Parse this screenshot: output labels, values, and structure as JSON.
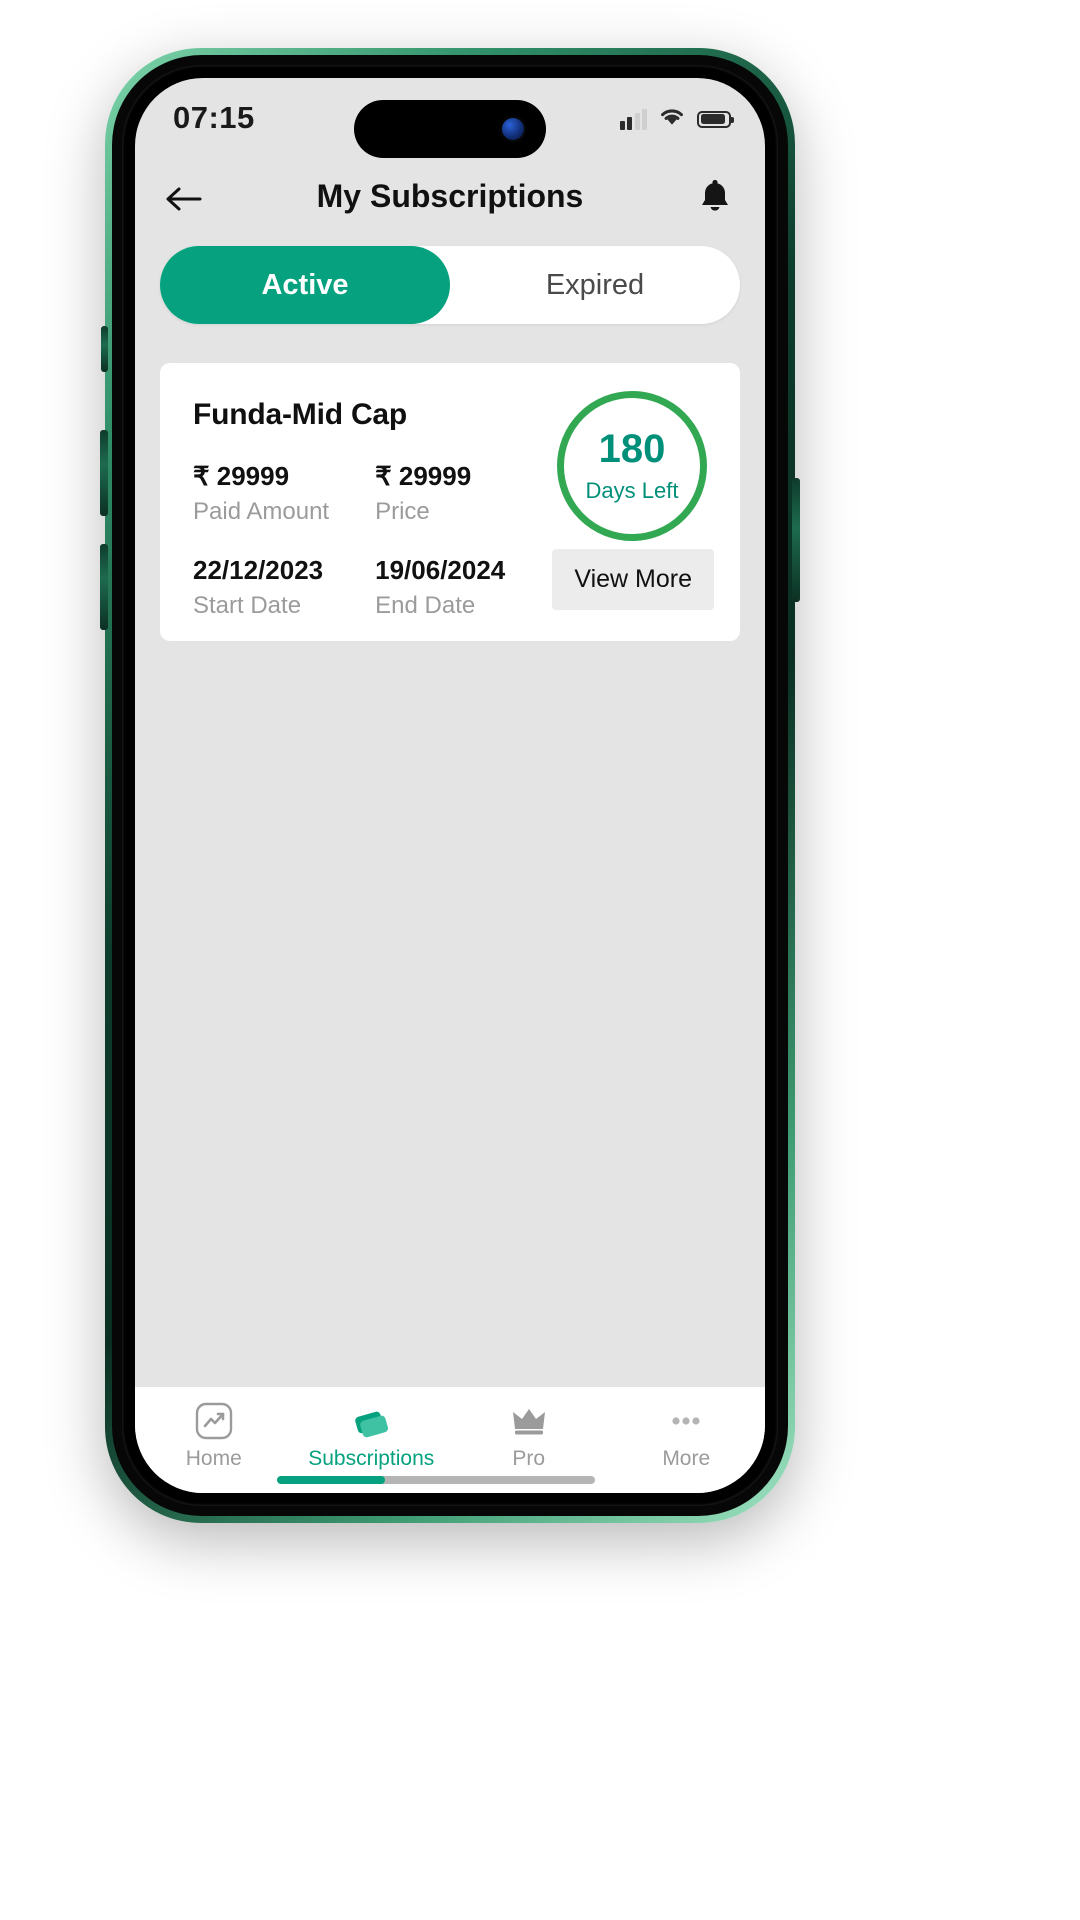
{
  "status_bar": {
    "time": "07:15",
    "signal_icon": "cellular-signal-icon",
    "signal_bars_filled": 2,
    "signal_bars_total": 4,
    "wifi_icon": "wifi-icon",
    "battery_icon": "battery-icon",
    "battery_level_percent": 80
  },
  "app_bar": {
    "back_icon": "arrow-left-icon",
    "title": "My Subscriptions",
    "notification_icon": "bell-icon"
  },
  "tabs": {
    "items": [
      {
        "label": "Active",
        "active": true
      },
      {
        "label": "Expired",
        "active": false
      }
    ]
  },
  "subscription_card": {
    "title": "Funda-Mid Cap",
    "paid_amount_value": "₹ 29999",
    "paid_amount_label": "Paid Amount",
    "price_value": "₹ 29999",
    "price_label": "Price",
    "start_date_value": "22/12/2023",
    "start_date_label": "Start Date",
    "end_date_value": "19/06/2024",
    "end_date_label": "End Date",
    "days_left_number": "180",
    "days_left_label": "Days Left",
    "view_more_label": "View More"
  },
  "bottom_nav": {
    "items": [
      {
        "label": "Home",
        "icon": "trending-chart-icon",
        "active": false
      },
      {
        "label": "Subscriptions",
        "icon": "cards-stack-icon",
        "active": true
      },
      {
        "label": "Pro",
        "icon": "crown-icon",
        "active": false
      },
      {
        "label": "More",
        "icon": "three-dots-icon",
        "active": false
      }
    ]
  },
  "colors": {
    "accent_teal": "#06a27f",
    "ring_green": "#32a852",
    "days_text": "#00907a",
    "screen_bg": "#e4e4e4",
    "card_bg": "#ffffff",
    "muted_text": "#9b9b9b"
  }
}
